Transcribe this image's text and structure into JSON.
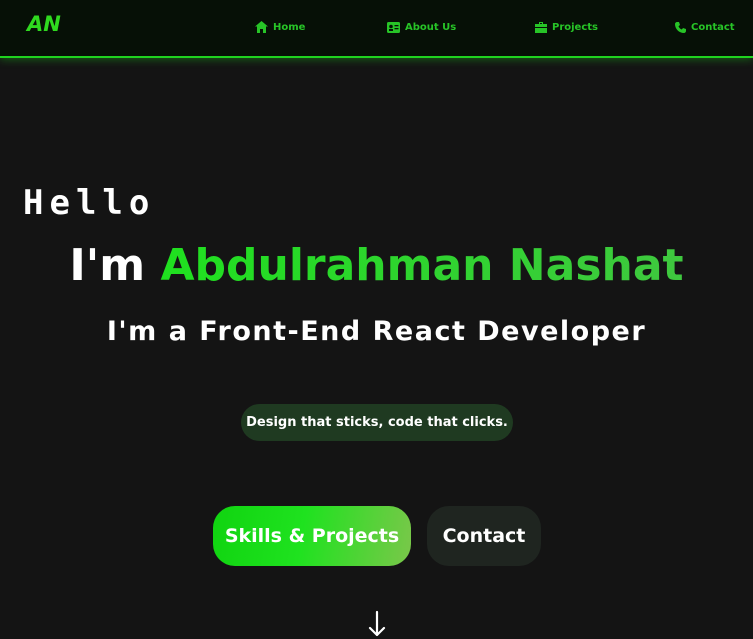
{
  "navbar": {
    "logo": "AN",
    "items": [
      {
        "label": "Home",
        "icon": "home-icon"
      },
      {
        "label": "About Us",
        "icon": "id-card-icon"
      },
      {
        "label": "Projects",
        "icon": "briefcase-icon"
      },
      {
        "label": "Contact",
        "icon": "phone-icon"
      }
    ]
  },
  "hero": {
    "greeting": "Hello",
    "intro": "I'm",
    "name": "Abdulrahman Nashat",
    "subtitle": "I'm a Front-End React Developer",
    "tagline": "Design that sticks, code that clicks.",
    "primary_button": "Skills & Projects",
    "secondary_button": "Contact",
    "scroll_icon": "arrow-down-icon"
  },
  "colors": {
    "background": "#141414",
    "accent": "#1fd31f",
    "nav_text": "#27c427",
    "tagline_bg": "#1f3a21",
    "secondary_button_bg": "#1f2520"
  }
}
